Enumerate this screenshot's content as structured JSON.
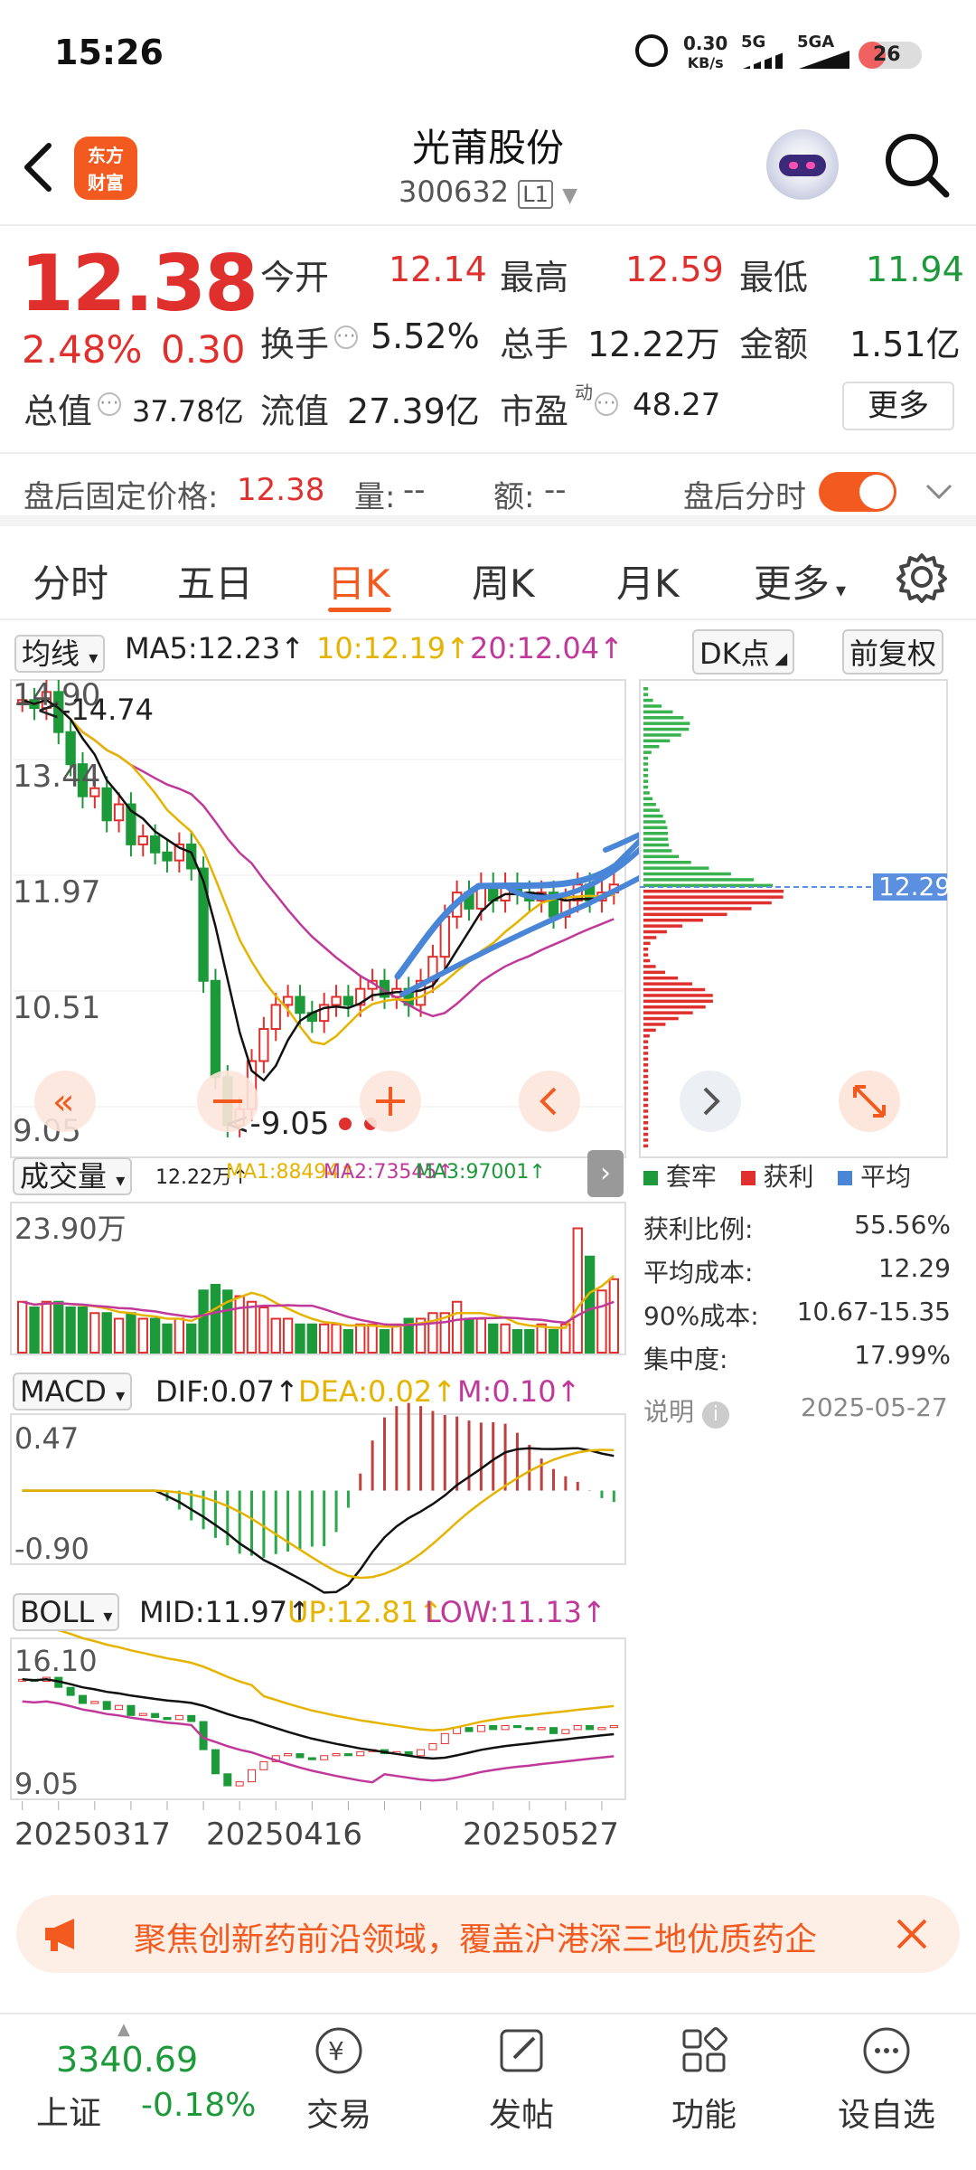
{
  "status": {
    "time": "15:26",
    "speed": "0.30",
    "speed_unit": "KB/s",
    "net1": "5G",
    "net2": "5GA",
    "battery": "26"
  },
  "header": {
    "logo_line1": "东方",
    "logo_line2": "财富",
    "title": "光莆股份",
    "code": "300632",
    "code_tag": "L1"
  },
  "quote": {
    "price": "12.38",
    "pct": "2.48%",
    "chg": "0.30",
    "open_label": "今开",
    "open": "12.14",
    "high_label": "最高",
    "high": "12.59",
    "low_label": "最低",
    "low": "11.94",
    "turnover_label": "换手",
    "turnover": "5.52%",
    "volume_label": "总手",
    "volume": "12.22万",
    "amount_label": "金额",
    "amount": "1.51亿",
    "mktcap_label": "总值",
    "mktcap": "37.78亿",
    "float_label": "流值",
    "float": "27.39亿",
    "pe_label": "市盈",
    "pe_sup": "动",
    "pe": "48.27",
    "more": "更多"
  },
  "after": {
    "label": "盘后固定价格:",
    "price": "12.38",
    "vol_label": "量:",
    "vol": "--",
    "amt_label": "额:",
    "amt": "--",
    "session_label": "盘后分时"
  },
  "tabs": [
    "分时",
    "五日",
    "日K",
    "周K",
    "月K",
    "更多"
  ],
  "kline": {
    "ma_select": "均线",
    "ma5": "MA5:12.23",
    "ma10": "10:12.19",
    "ma20": "20:12.04",
    "dk": "DK点",
    "adjust": "前复权",
    "y_labels": [
      "14.90",
      "13.44",
      "11.97",
      "10.51",
      "9.05"
    ],
    "max_mark": "14.74",
    "min_mark": "<-9.05",
    "chip_price": "12.29"
  },
  "vol": {
    "select": "成交量",
    "cur": "12.22万",
    "ma1": "MA1:88494",
    "ma2": "MA2:73545",
    "ma3": "MA3:97001",
    "ylabel": "23.90万"
  },
  "macd": {
    "select": "MACD",
    "dif": "DIF:0.07",
    "dea": "DEA:0.02",
    "m": "M:0.10",
    "ytop": "0.47",
    "ybot": "-0.90"
  },
  "boll": {
    "select": "BOLL",
    "mid": "MID:11.97",
    "up": "UP:12.81",
    "low": "LOW:11.13",
    "ytop": "16.10",
    "ybot": "9.05"
  },
  "dates": [
    "20250317",
    "20250416",
    "20250527"
  ],
  "chips": {
    "legend": [
      "套牢",
      "获利",
      "平均"
    ],
    "rows": [
      [
        "获利比例:",
        "55.56%"
      ],
      [
        "平均成本:",
        "12.29"
      ],
      [
        "90%成本:",
        "10.67-15.35"
      ],
      [
        "集中度:",
        "17.99%"
      ]
    ],
    "note": "说明",
    "date": "2025-05-27"
  },
  "banner": {
    "text": "聚焦创新药前沿领域，覆盖沪港深三地优质药企"
  },
  "bottom": {
    "index_val": "3340.69",
    "index_name": "上证",
    "index_chg": "-0.18%",
    "nav": [
      "交易",
      "发帖",
      "功能",
      "设自选"
    ]
  },
  "colors": {
    "red": "#e0302e",
    "green": "#1c9a3a",
    "accent": "#f25a1f",
    "ma10": "#e6b400",
    "ma20": "#c0399a",
    "blue": "#4a86d8"
  }
}
